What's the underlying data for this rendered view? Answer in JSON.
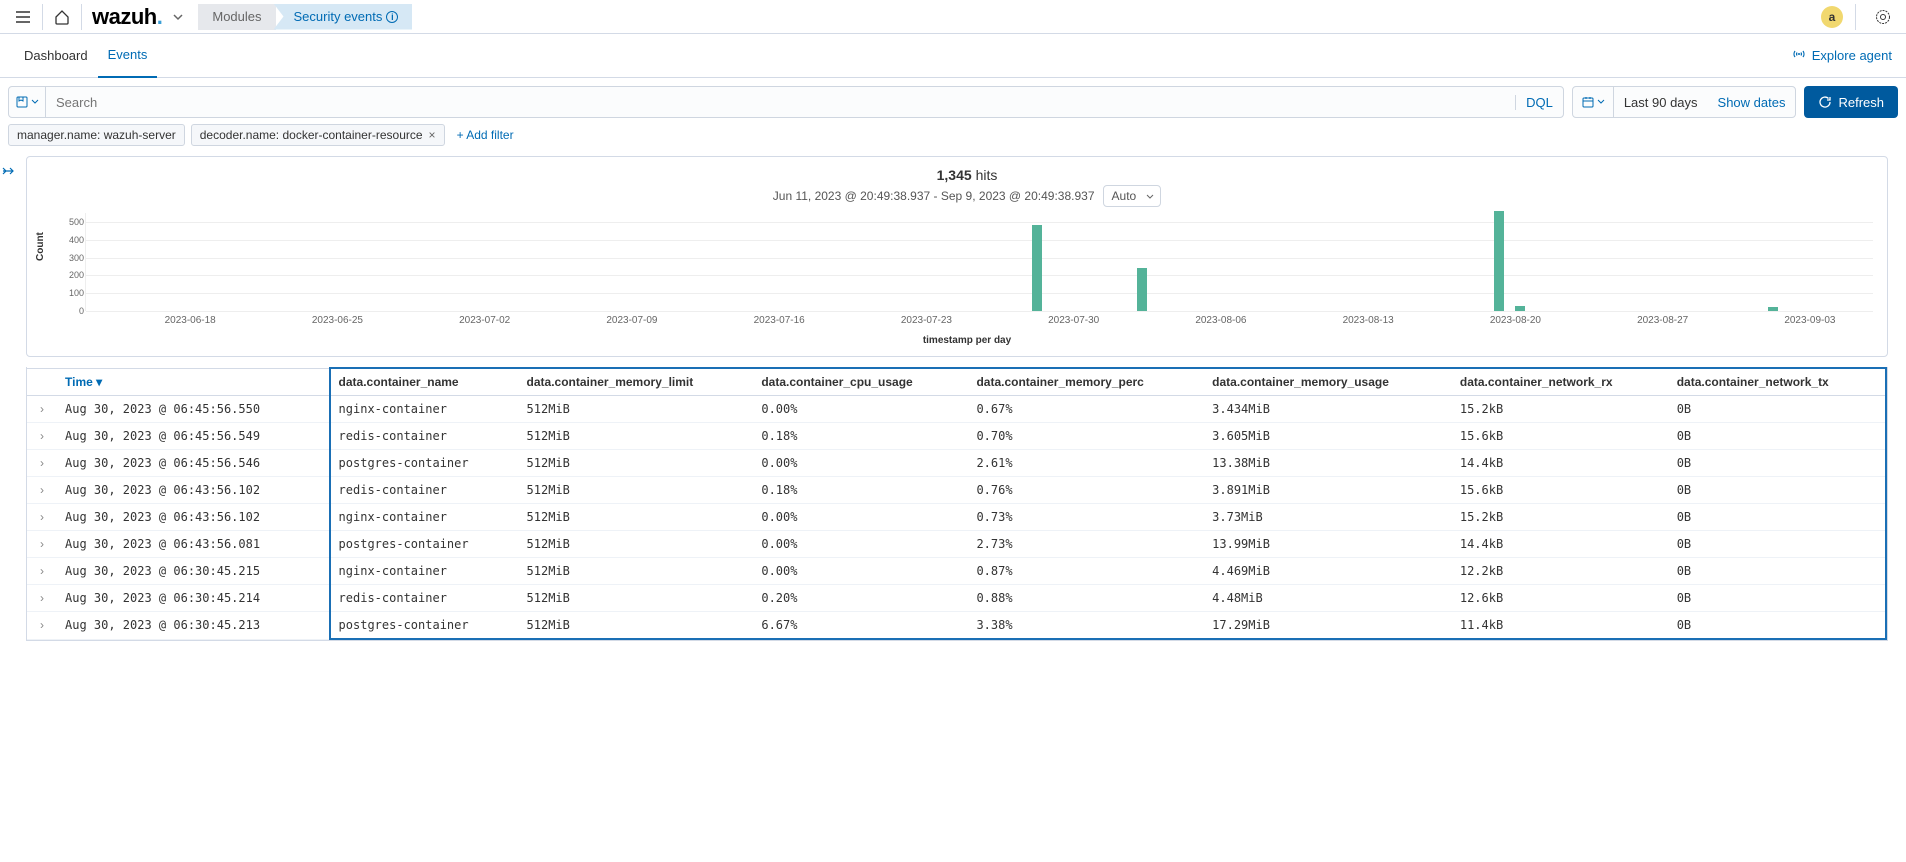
{
  "topbar": {
    "logo": "wazuh",
    "breadcrumb": {
      "modules": "Modules",
      "security": "Security events"
    },
    "avatar": "a"
  },
  "subnav": {
    "tabs": [
      "Dashboard",
      "Events"
    ],
    "active": 1,
    "explore": "Explore agent"
  },
  "query": {
    "search_placeholder": "Search",
    "dql": "DQL",
    "date_text": "Last 90 days",
    "show_dates": "Show dates",
    "refresh": "Refresh"
  },
  "filters": {
    "chips": [
      {
        "label": "manager.name: wazuh-server",
        "removable": false
      },
      {
        "label": "decoder.name: docker-container-resource",
        "removable": true
      }
    ],
    "add": "+ Add filter"
  },
  "hits": {
    "count": "1,345",
    "suffix": "hits",
    "range": "Jun 11, 2023 @ 20:49:38.937 - Sep 9, 2023 @ 20:49:38.937",
    "interval": "Auto",
    "ylabel": "Count",
    "xlabel": "timestamp per day"
  },
  "chart_data": {
    "type": "bar",
    "ylabel": "Count",
    "xlabel": "timestamp per day",
    "ylim": [
      0,
      550
    ],
    "yticks": [
      0,
      100,
      200,
      300,
      400,
      500
    ],
    "xticks": [
      "2023-06-18",
      "2023-06-25",
      "2023-07-02",
      "2023-07-09",
      "2023-07-16",
      "2023-07-23",
      "2023-07-30",
      "2023-08-06",
      "2023-08-13",
      "2023-08-20",
      "2023-08-27",
      "2023-09-03"
    ],
    "bars": [
      {
        "x": "2023-07-28",
        "value": 480
      },
      {
        "x": "2023-08-02",
        "value": 240
      },
      {
        "x": "2023-08-19",
        "value": 560
      },
      {
        "x": "2023-08-20",
        "value": 30
      },
      {
        "x": "2023-09-01",
        "value": 20
      }
    ]
  },
  "table": {
    "columns": [
      "Time",
      "data.container_name",
      "data.container_memory_limit",
      "data.container_cpu_usage",
      "data.container_memory_perc",
      "data.container_memory_usage",
      "data.container_network_rx",
      "data.container_network_tx"
    ],
    "rows": [
      [
        "Aug 30, 2023 @ 06:45:56.550",
        "nginx-container",
        "512MiB",
        "0.00%",
        "0.67%",
        "3.434MiB",
        "15.2kB",
        "0B"
      ],
      [
        "Aug 30, 2023 @ 06:45:56.549",
        "redis-container",
        "512MiB",
        "0.18%",
        "0.70%",
        "3.605MiB",
        "15.6kB",
        "0B"
      ],
      [
        "Aug 30, 2023 @ 06:45:56.546",
        "postgres-container",
        "512MiB",
        "0.00%",
        "2.61%",
        "13.38MiB",
        "14.4kB",
        "0B"
      ],
      [
        "Aug 30, 2023 @ 06:43:56.102",
        "redis-container",
        "512MiB",
        "0.18%",
        "0.76%",
        "3.891MiB",
        "15.6kB",
        "0B"
      ],
      [
        "Aug 30, 2023 @ 06:43:56.102",
        "nginx-container",
        "512MiB",
        "0.00%",
        "0.73%",
        "3.73MiB",
        "15.2kB",
        "0B"
      ],
      [
        "Aug 30, 2023 @ 06:43:56.081",
        "postgres-container",
        "512MiB",
        "0.00%",
        "2.73%",
        "13.99MiB",
        "14.4kB",
        "0B"
      ],
      [
        "Aug 30, 2023 @ 06:30:45.215",
        "nginx-container",
        "512MiB",
        "0.00%",
        "0.87%",
        "4.469MiB",
        "12.2kB",
        "0B"
      ],
      [
        "Aug 30, 2023 @ 06:30:45.214",
        "redis-container",
        "512MiB",
        "0.20%",
        "0.88%",
        "4.48MiB",
        "12.6kB",
        "0B"
      ],
      [
        "Aug 30, 2023 @ 06:30:45.213",
        "postgres-container",
        "512MiB",
        "6.67%",
        "3.38%",
        "17.29MiB",
        "11.4kB",
        "0B"
      ]
    ]
  }
}
